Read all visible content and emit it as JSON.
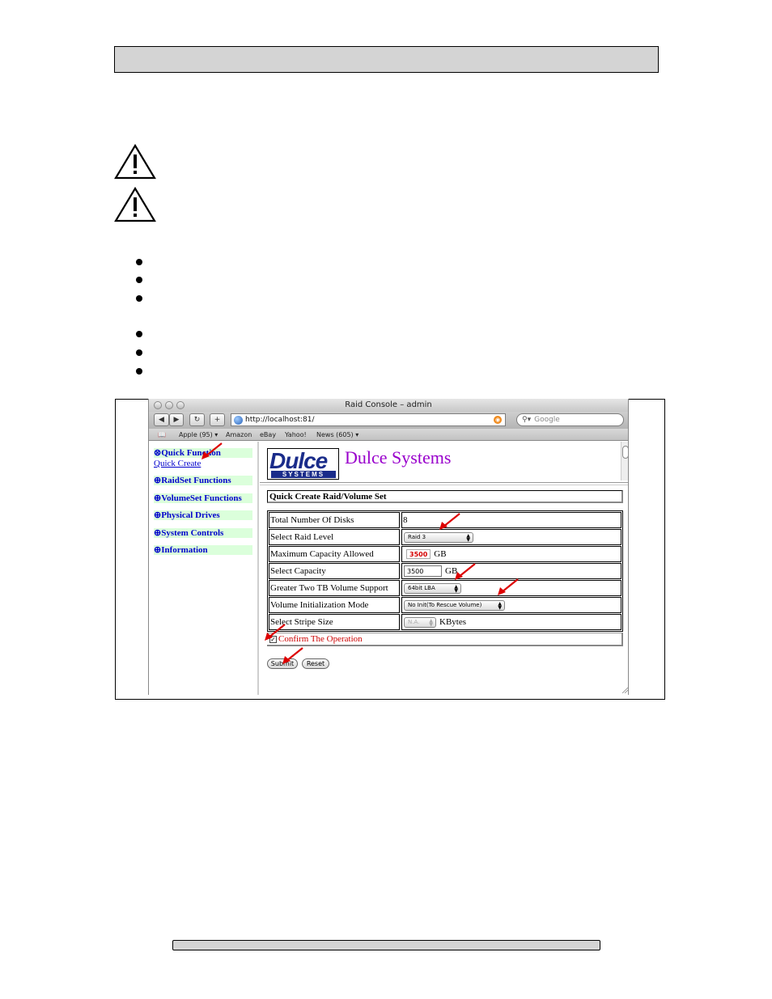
{
  "browser": {
    "window_title": "Raid Console – admin",
    "url": "http://localhost:81/",
    "search_placeholder": "Google",
    "bookmarks": [
      "Apple (95) ▾",
      "Amazon",
      "eBay",
      "Yahoo!",
      "News (605) ▾"
    ]
  },
  "sidebar": {
    "quick_function": "⊗Quick Function",
    "quick_create": "Quick Create",
    "raidset": "⊕RaidSet Functions",
    "volumeset": "⊕VolumeSet Functions",
    "physical": "⊕Physical Drives",
    "system": "⊕System Controls",
    "information": "⊕Information"
  },
  "header": {
    "logo_text": "Dulce",
    "logo_sub": "SYSTEMS",
    "brand": "Dulce Systems"
  },
  "form": {
    "title": "Quick Create Raid/Volume Set",
    "rows": {
      "disks_label": "Total Number Of Disks",
      "disks_value": "8",
      "raid_level_label": "Select Raid Level",
      "raid_level_value": "Raid 3",
      "max_cap_label": "Maximum Capacity Allowed",
      "max_cap_value": "3500",
      "max_cap_unit": "GB",
      "sel_cap_label": "Select Capacity",
      "sel_cap_value": "3500",
      "sel_cap_unit": "GB",
      "tb_label": "Greater Two TB Volume Support",
      "tb_value": "64bit LBA",
      "init_label": "Volume Initialization Mode",
      "init_value": "No Init(To Rescue Volume)",
      "stripe_label": "Select Stripe Size",
      "stripe_value": "N.A.",
      "stripe_unit": "KBytes"
    },
    "confirm_label": "Confirm The Operation",
    "submit_label": "Submit",
    "reset_label": "Reset"
  }
}
